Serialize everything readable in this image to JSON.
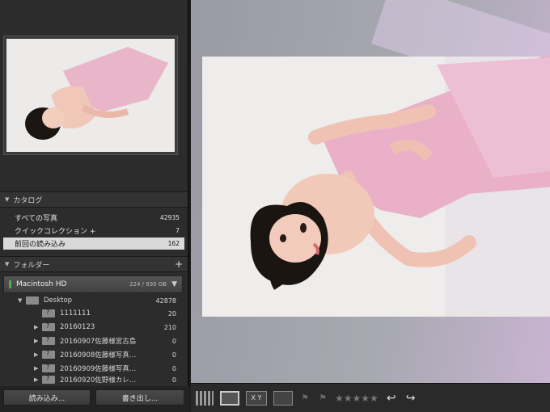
{
  "catalog": {
    "header": "カタログ",
    "rows": [
      {
        "label": "すべての写真",
        "count": "42935"
      },
      {
        "label": "クイックコレクション +",
        "count": "7"
      },
      {
        "label": "前回の読み込み",
        "count": "162"
      }
    ]
  },
  "folders": {
    "header": "フォルダー",
    "add_label": "+",
    "volume": {
      "name": "Macintosh HD",
      "space": "224 / 930 GB"
    },
    "items": [
      {
        "name": "Desktop",
        "count": "42878"
      },
      {
        "name": "1111111",
        "count": "20"
      },
      {
        "name": "20160123",
        "count": "210"
      },
      {
        "name": "20160907佐藤様宮古島",
        "count": "0"
      },
      {
        "name": "20160908佐藤様写真…",
        "count": "0"
      },
      {
        "name": "20160909佐藤様写真…",
        "count": "0"
      },
      {
        "name": "20160920佐野様カレ…",
        "count": "0"
      }
    ]
  },
  "buttons": {
    "import": "読み込み...",
    "export": "書き出し..."
  },
  "toolbar": {
    "xy_label": "X Y",
    "stars": "★★★★★",
    "rotate_left": "↩",
    "rotate_right": "↪"
  }
}
